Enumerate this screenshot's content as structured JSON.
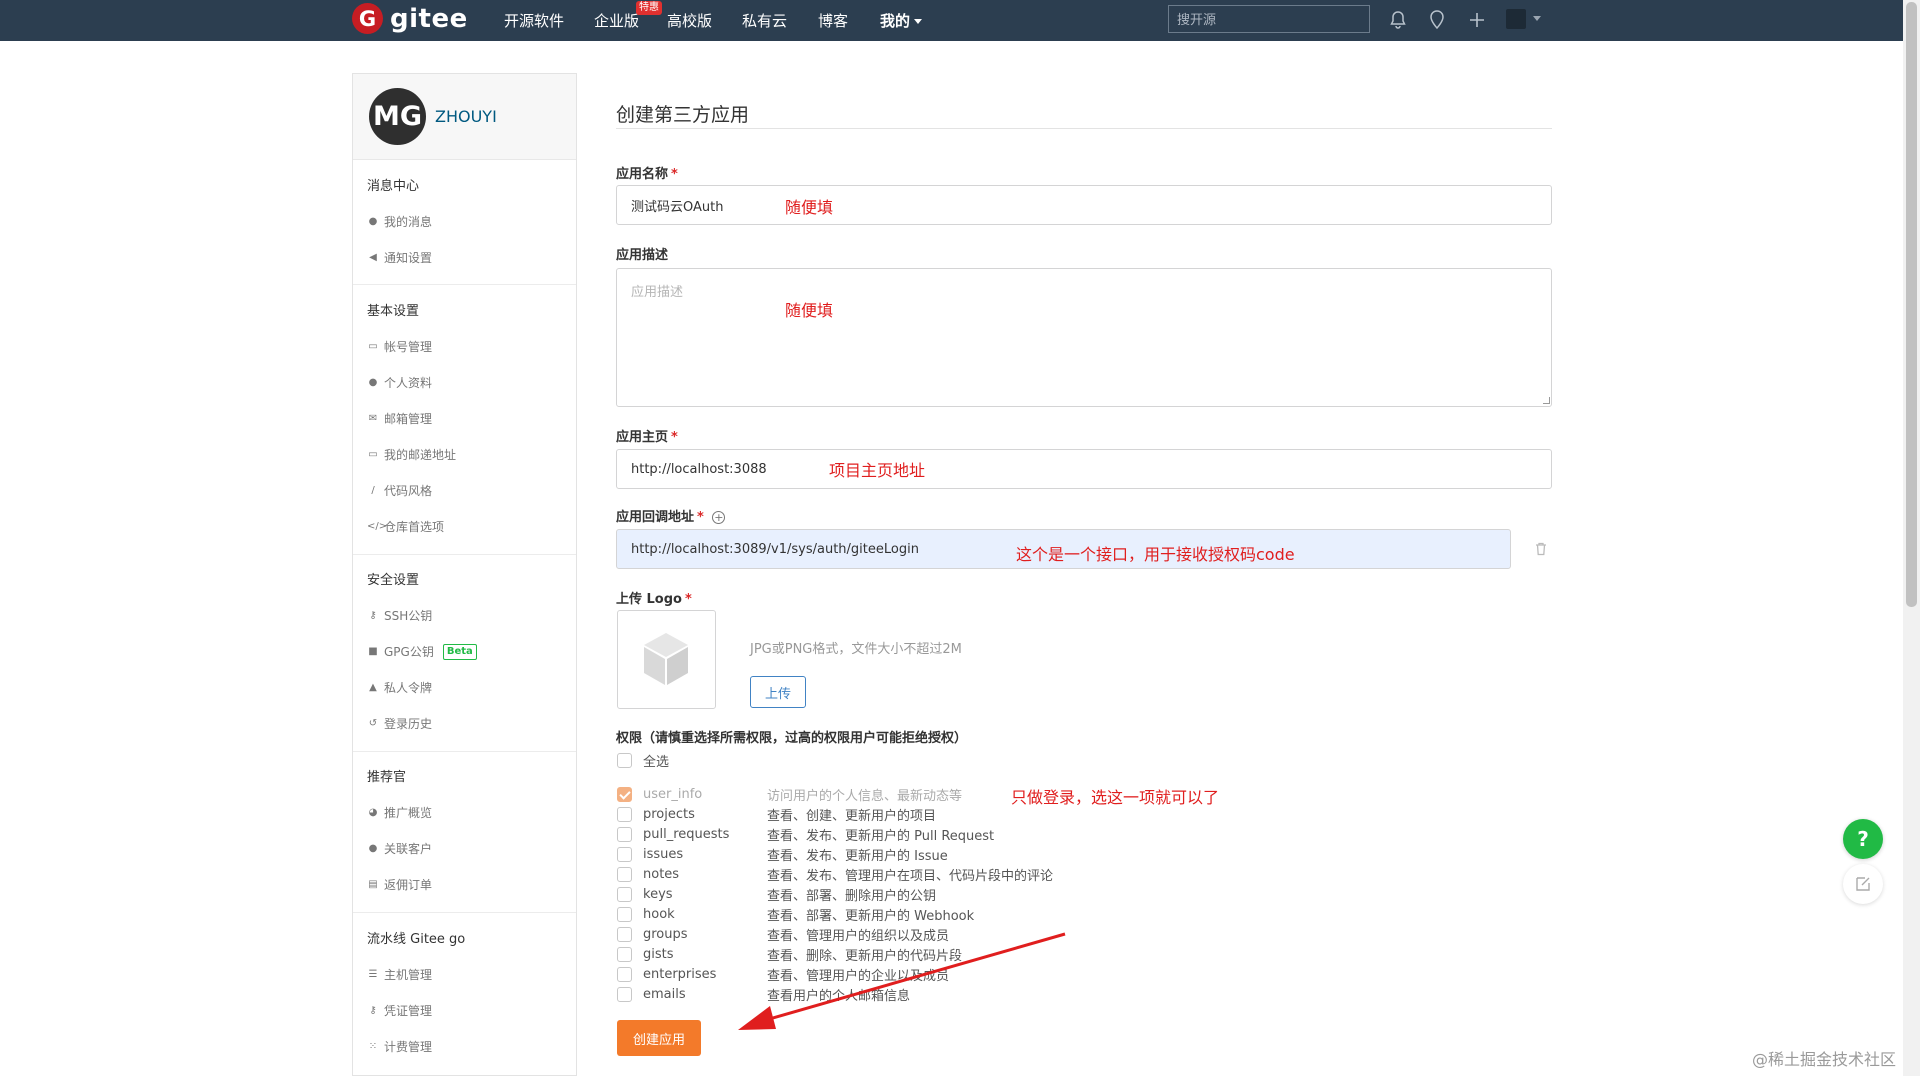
{
  "nav": {
    "logo_text": "gitee",
    "items": [
      "开源软件",
      "企业版",
      "高校版",
      "私有云",
      "博客"
    ],
    "badge": "特惠",
    "mine": "我的",
    "search_placeholder": "搜开源"
  },
  "sidebar": {
    "avatar_initials": "MG",
    "username": "ZHOUYI",
    "sections": [
      {
        "title": "消息中心",
        "items": [
          "我的消息",
          "通知设置"
        ]
      },
      {
        "title": "基本设置",
        "items": [
          "帐号管理",
          "个人资料",
          "邮箱管理",
          "我的邮递地址",
          "代码风格",
          "仓库首选项"
        ]
      },
      {
        "title": "安全设置",
        "items": [
          "SSH公钥",
          "GPG公钥",
          "私人令牌",
          "登录历史"
        ]
      },
      {
        "title": "推荐官",
        "items": [
          "推广概览",
          "关联客户",
          "返佣订单"
        ]
      },
      {
        "title": "流水线 Gitee go",
        "items": [
          "主机管理",
          "凭证管理",
          "计费管理"
        ]
      }
    ],
    "beta_label": "Beta"
  },
  "form": {
    "title": "创建第三方应用",
    "name_label": "应用名称",
    "name_value": "测试码云OAuth",
    "desc_label": "应用描述",
    "desc_placeholder": "应用描述",
    "home_label": "应用主页",
    "home_value": "http://localhost:3088",
    "callback_label": "应用回调地址",
    "callback_value": "http://localhost:3089/v1/sys/auth/giteeLogin",
    "logo_label": "上传 Logo",
    "logo_hint": "JPG或PNG格式，文件大小不超过2M",
    "upload_button": "上传",
    "required_mark": "*",
    "perm_title": "权限（请慎重选择所需权限，过高的权限用户可能拒绝授权）",
    "select_all": "全选",
    "scopes": [
      {
        "name": "user_info",
        "desc": "访问用户的个人信息、最新动态等",
        "checked": true
      },
      {
        "name": "projects",
        "desc": "查看、创建、更新用户的项目",
        "checked": false
      },
      {
        "name": "pull_requests",
        "desc": "查看、发布、更新用户的 Pull Request",
        "checked": false
      },
      {
        "name": "issues",
        "desc": "查看、发布、更新用户的 Issue",
        "checked": false
      },
      {
        "name": "notes",
        "desc": "查看、发布、管理用户在项目、代码片段中的评论",
        "checked": false
      },
      {
        "name": "keys",
        "desc": "查看、部署、删除用户的公钥",
        "checked": false
      },
      {
        "name": "hook",
        "desc": "查看、部署、更新用户的 Webhook",
        "checked": false
      },
      {
        "name": "groups",
        "desc": "查看、管理用户的组织以及成员",
        "checked": false
      },
      {
        "name": "gists",
        "desc": "查看、删除、更新用户的代码片段",
        "checked": false
      },
      {
        "name": "enterprises",
        "desc": "查看、管理用户的企业以及成员",
        "checked": false
      },
      {
        "name": "emails",
        "desc": "查看用户的个人邮箱信息",
        "checked": false
      }
    ],
    "create_button": "创建应用"
  },
  "annotations": {
    "name_note": "随便填",
    "desc_note": "随便填",
    "home_note": "项目主页地址",
    "callback_note": "这个是一个接口，用于接收授权码code",
    "scope_note": "只做登录，选这一项就可以了"
  },
  "float": {
    "help": "?"
  },
  "watermark": "@稀土掘金技术社区",
  "colors": {
    "nav_bg": "#2c3e50",
    "brand_red": "#c71d23",
    "create_orange": "#f37a2a",
    "annotation_red": "#e01e1e",
    "help_green": "#21ba45"
  }
}
